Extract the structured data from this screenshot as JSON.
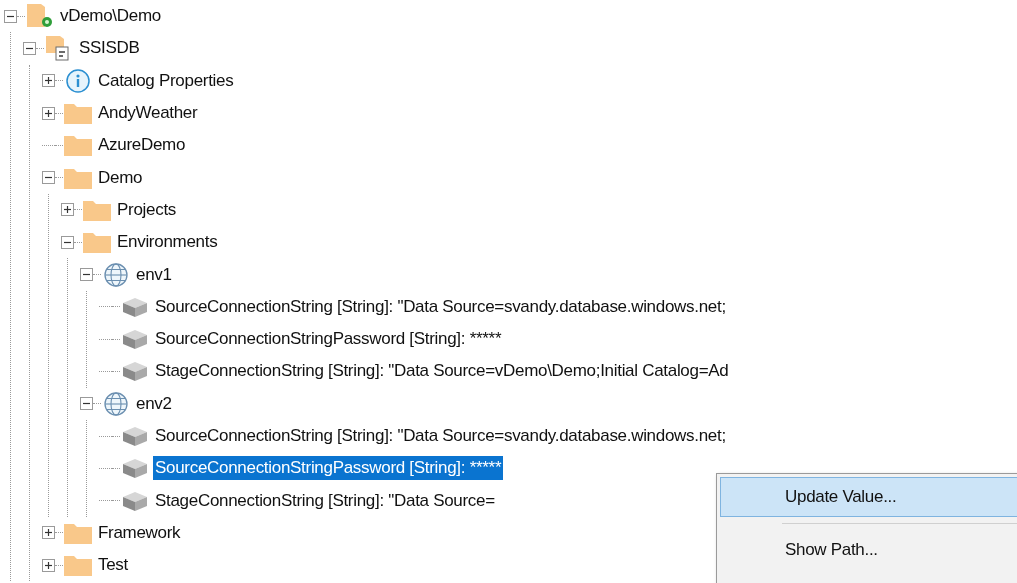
{
  "tree": [
    {
      "kind": "server",
      "label": "vDemo\\Demo",
      "expanded": true,
      "selected": false,
      "children": [
        {
          "kind": "database",
          "label": "SSISDB",
          "expanded": true,
          "selected": false,
          "children": [
            {
              "kind": "info",
              "label": "Catalog Properties",
              "expanded": false,
              "selected": false
            },
            {
              "kind": "folder",
              "label": "AndyWeather",
              "expanded": false,
              "selected": false
            },
            {
              "kind": "folder",
              "label": "AzureDemo",
              "selected": false
            },
            {
              "kind": "folder",
              "label": "Demo",
              "expanded": true,
              "selected": false,
              "children": [
                {
                  "kind": "folder",
                  "label": "Projects",
                  "expanded": false,
                  "selected": false
                },
                {
                  "kind": "folder",
                  "label": "Environments",
                  "expanded": true,
                  "selected": false,
                  "children": [
                    {
                      "kind": "environment",
                      "label": "env1",
                      "expanded": true,
                      "selected": false,
                      "children": [
                        {
                          "kind": "variable",
                          "label": "SourceConnectionString [String]: \"Data Source=svandy.database.windows.net;",
                          "selected": false
                        },
                        {
                          "kind": "variable",
                          "label": "SourceConnectionStringPassword [String]: *****",
                          "selected": false
                        },
                        {
                          "kind": "variable",
                          "label": "StageConnectionString [String]: \"Data Source=vDemo\\Demo;Initial Catalog=Ad",
                          "selected": false
                        }
                      ]
                    },
                    {
                      "kind": "environment",
                      "label": "env2",
                      "expanded": true,
                      "selected": false,
                      "children": [
                        {
                          "kind": "variable",
                          "label": "SourceConnectionString [String]: \"Data Source=svandy.database.windows.net;",
                          "selected": false
                        },
                        {
                          "kind": "variable",
                          "label": "SourceConnectionStringPassword [String]: *****",
                          "selected": true
                        },
                        {
                          "kind": "variable",
                          "label": "StageConnectionString [String]: \"Data Source=",
                          "selected": false
                        }
                      ]
                    }
                  ]
                }
              ]
            },
            {
              "kind": "folder",
              "label": "Framework",
              "expanded": false,
              "selected": false
            },
            {
              "kind": "folder",
              "label": "Test",
              "expanded": false,
              "selected": false
            }
          ]
        }
      ]
    }
  ],
  "context_menu": {
    "items": [
      {
        "label": "Update Value...",
        "selected": true
      },
      {
        "label": "Show Path...",
        "selected": false
      }
    ]
  }
}
